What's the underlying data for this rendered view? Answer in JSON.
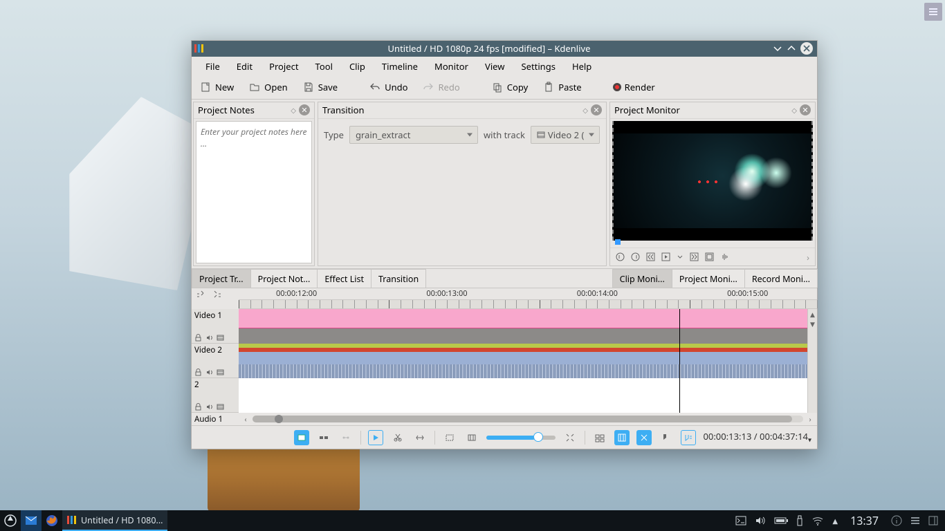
{
  "window": {
    "title": "Untitled / HD 1080p 24 fps [modified] – Kdenlive"
  },
  "menubar": [
    "File",
    "Edit",
    "Project",
    "Tool",
    "Clip",
    "Timeline",
    "Monitor",
    "View",
    "Settings",
    "Help"
  ],
  "toolbar": {
    "new": "New",
    "open": "Open",
    "save": "Save",
    "undo": "Undo",
    "redo": "Redo",
    "copy": "Copy",
    "paste": "Paste",
    "render": "Render"
  },
  "panels": {
    "notes": {
      "title": "Project Notes",
      "placeholder": "Enter your project notes here ..."
    },
    "transition": {
      "title": "Transition",
      "type_label": "Type",
      "type_value": "grain_extract",
      "with_track_label": "with track",
      "track_value": "Video 2 ("
    },
    "monitor": {
      "title": "Project Monitor"
    }
  },
  "left_tabs": [
    "Project Tr...",
    "Project Not...",
    "Effect List",
    "Transition"
  ],
  "right_tabs": [
    "Clip Moni...",
    "Project Moni...",
    "Record Moni..."
  ],
  "ruler_times": [
    "00:00:12:00",
    "00:00:13:00",
    "00:00:14:00",
    "00:00:15:00"
  ],
  "tracks": {
    "v1": "Video 1",
    "v2": "Video 2",
    "t2": "2",
    "a1": "Audio 1"
  },
  "status": {
    "current": "00:00:13:13",
    "total": "00:04:37:14"
  },
  "taskbar": {
    "app_title": "Untitled / HD 1080...",
    "clock": "13:37"
  }
}
